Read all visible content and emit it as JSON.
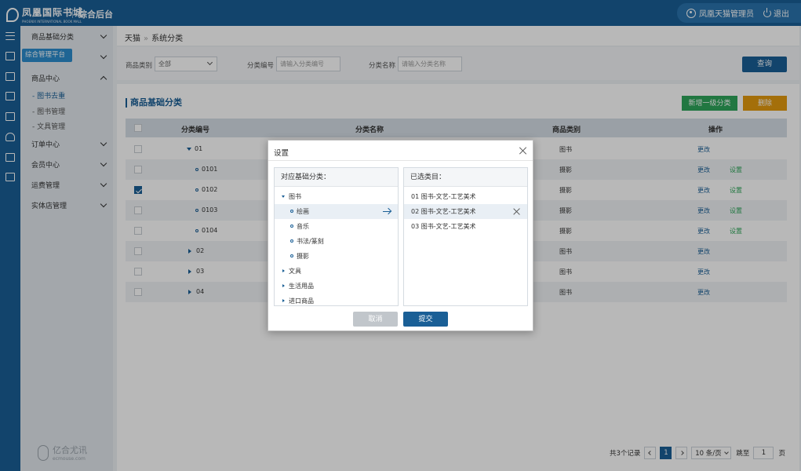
{
  "header": {
    "brand": "凤凰国际书城",
    "brand_sub": "PHOENIX INTERNATIONAL BOOK MALL",
    "title": "综合后台",
    "user": "凤凰天猫管理员",
    "logout": "退出"
  },
  "sidebar": {
    "tooltip": "综合管理平台",
    "items": [
      {
        "label": "商品基础分类",
        "expanded": false
      },
      {
        "label": "",
        "expanded": false
      },
      {
        "label": "商品中心",
        "expanded": true
      },
      {
        "label": "订单中心",
        "expanded": false
      },
      {
        "label": "会员中心",
        "expanded": false
      },
      {
        "label": "运费管理",
        "expanded": false
      },
      {
        "label": "实体店管理",
        "expanded": false
      }
    ],
    "sub_items": [
      "- 图书去重",
      "- 图书管理",
      "- 文具管理"
    ],
    "footer_name": "亿合尤讯",
    "footer_url": "ecmouse.com"
  },
  "breadcrumb": [
    "天猫",
    "系统分类"
  ],
  "breadcrumb_sep": "»",
  "filters": {
    "category_label": "商品类别",
    "category_value": "全部",
    "code_label": "分类编号",
    "code_placeholder": "请输入分类编号",
    "name_label": "分类名称",
    "name_placeholder": "请输入分类名称",
    "query_button": "查询"
  },
  "section": {
    "title": "商品基础分类",
    "add_button": "新增一级分类",
    "delete_button": "删除"
  },
  "table": {
    "headers": [
      "分类编号",
      "分类名称",
      "商品类别",
      "操作"
    ],
    "rows": [
      {
        "code": "01",
        "category": "图书",
        "edit": "更改",
        "set": ""
      },
      {
        "code": "0101",
        "category": "摄影",
        "edit": "更改",
        "set": "设置"
      },
      {
        "code": "0102",
        "category": "摄影",
        "edit": "更改",
        "set": "设置"
      },
      {
        "code": "0103",
        "category": "摄影",
        "edit": "更改",
        "set": "设置"
      },
      {
        "code": "0104",
        "category": "摄影",
        "edit": "更改",
        "set": "设置"
      },
      {
        "code": "02",
        "category": "图书",
        "edit": "更改",
        "set": ""
      },
      {
        "code": "03",
        "category": "图书",
        "edit": "更改",
        "set": ""
      },
      {
        "code": "04",
        "category": "图书",
        "edit": "更改",
        "set": ""
      }
    ]
  },
  "pagination": {
    "total": "共3个记录",
    "current": "1",
    "page_size": "10 条/页",
    "jump_label": "跳至",
    "jump_value": "1",
    "page_unit": "页"
  },
  "modal": {
    "title": "设置",
    "left_title": "对应基础分类：",
    "right_title": "已选类目：",
    "tree": [
      "图书",
      "绘画",
      "音乐",
      "书法/篆刻",
      "摄影",
      "文具",
      "生活用品",
      "进口商品"
    ],
    "selected": [
      "01  图书-文艺-工艺美术",
      "02  图书-文艺-工艺美术",
      "03  图书-文艺-工艺美术"
    ],
    "cancel": "取消",
    "submit": "提交"
  },
  "colors": {
    "primary": "#1a5f96",
    "success": "#2fa65a",
    "warning": "#e49a0f"
  }
}
